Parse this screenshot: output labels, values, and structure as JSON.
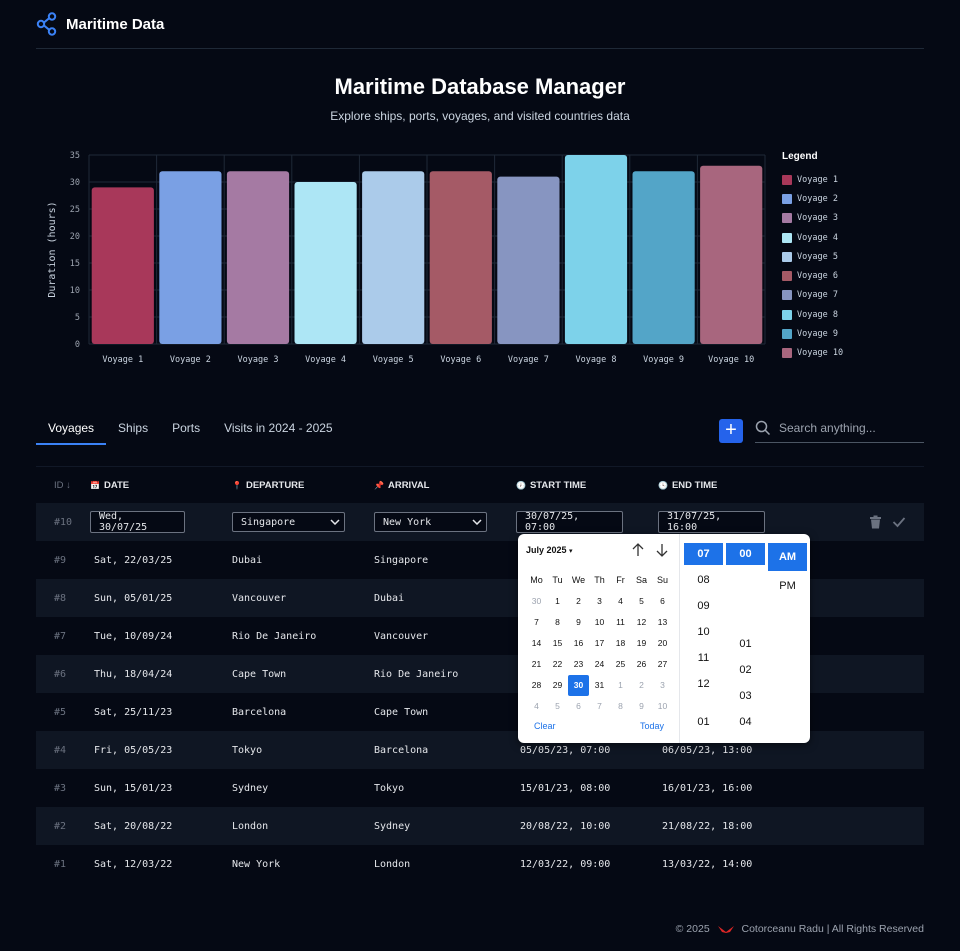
{
  "header": {
    "brand": "Maritime Data"
  },
  "hero": {
    "title": "Maritime Database Manager",
    "subtitle": "Explore ships, ports, voyages, and visited countries data"
  },
  "chart_data": {
    "type": "bar",
    "title": "",
    "xlabel": "",
    "ylabel": "Duration (hours)",
    "ylim": [
      0,
      35
    ],
    "yticks": [
      0,
      5,
      10,
      15,
      20,
      25,
      30,
      35
    ],
    "categories": [
      "Voyage 1",
      "Voyage 2",
      "Voyage 3",
      "Voyage 4",
      "Voyage 5",
      "Voyage 6",
      "Voyage 7",
      "Voyage 8",
      "Voyage 9",
      "Voyage 10"
    ],
    "values": [
      29,
      32,
      32,
      30,
      32,
      32,
      31,
      35,
      32,
      33
    ],
    "colors": [
      "#a8385a",
      "#7aa0e4",
      "#a57aa3",
      "#ade6f5",
      "#abcbea",
      "#a55a66",
      "#8795c1",
      "#7dd2ea",
      "#53a5c8",
      "#a8667e"
    ],
    "legend_title": "Legend",
    "legend_position": "right",
    "grid": true
  },
  "tabs": [
    "Voyages",
    "Ships",
    "Ports",
    "Visits in 2024 - 2025"
  ],
  "search": {
    "placeholder": "Search anything..."
  },
  "add_label": "+",
  "table": {
    "headers": {
      "id": "ID",
      "date": "DATE",
      "departure": "DEPARTURE",
      "arrival": "ARRIVAL",
      "start": "START TIME",
      "end": "END TIME"
    },
    "edit_row": {
      "id": "#10",
      "date": "Wed, 30/07/25",
      "departure": "Singapore",
      "arrival": "New York",
      "start": "30/07/25, 07:00",
      "end": "31/07/25, 16:00"
    },
    "rows": [
      {
        "id": "#9",
        "date": "Sat, 22/03/25",
        "departure": "Dubai",
        "arrival": "Singapore",
        "start": "",
        "end": ""
      },
      {
        "id": "#8",
        "date": "Sun, 05/01/25",
        "departure": "Vancouver",
        "arrival": "Dubai",
        "start": "",
        "end": ""
      },
      {
        "id": "#7",
        "date": "Tue, 10/09/24",
        "departure": "Rio De Janeiro",
        "arrival": "Vancouver",
        "start": "",
        "end": ""
      },
      {
        "id": "#6",
        "date": "Thu, 18/04/24",
        "departure": "Cape Town",
        "arrival": "Rio De Janeiro",
        "start": "",
        "end": ""
      },
      {
        "id": "#5",
        "date": "Sat, 25/11/23",
        "departure": "Barcelona",
        "arrival": "Cape Town",
        "start": "",
        "end": ""
      },
      {
        "id": "#4",
        "date": "Fri, 05/05/23",
        "departure": "Tokyo",
        "arrival": "Barcelona",
        "start": "05/05/23, 07:00",
        "end": "06/05/23, 13:00"
      },
      {
        "id": "#3",
        "date": "Sun, 15/01/23",
        "departure": "Sydney",
        "arrival": "Tokyo",
        "start": "15/01/23, 08:00",
        "end": "16/01/23, 16:00"
      },
      {
        "id": "#2",
        "date": "Sat, 20/08/22",
        "departure": "London",
        "arrival": "Sydney",
        "start": "20/08/22, 10:00",
        "end": "21/08/22, 18:00"
      },
      {
        "id": "#1",
        "date": "Sat, 12/03/22",
        "departure": "New York",
        "arrival": "London",
        "start": "12/03/22, 09:00",
        "end": "13/03/22, 14:00"
      }
    ]
  },
  "datepicker": {
    "month": "July 2025",
    "weekdays": [
      "Mo",
      "Tu",
      "We",
      "Th",
      "Fr",
      "Sa",
      "Su"
    ],
    "weeks": [
      [
        "30",
        "1",
        "2",
        "3",
        "4",
        "5",
        "6"
      ],
      [
        "7",
        "8",
        "9",
        "10",
        "11",
        "12",
        "13"
      ],
      [
        "14",
        "15",
        "16",
        "17",
        "18",
        "19",
        "20"
      ],
      [
        "21",
        "22",
        "23",
        "24",
        "25",
        "26",
        "27"
      ],
      [
        "28",
        "29",
        "30",
        "31",
        "1",
        "2",
        "3"
      ],
      [
        "4",
        "5",
        "6",
        "7",
        "8",
        "9",
        "10"
      ]
    ],
    "selected_day": "30",
    "clear": "Clear",
    "today": "Today",
    "hours": [
      "07",
      "08",
      "09",
      "10",
      "11",
      "12",
      "01"
    ],
    "minutes": [
      "00",
      "01",
      "02",
      "03",
      "04"
    ],
    "ampm": [
      "AM",
      "PM"
    ],
    "selected_hour": "07",
    "selected_minute": "00",
    "selected_ampm": "AM"
  },
  "footer": {
    "year": "© 2025",
    "text": "Cotorceanu Radu | All Rights Reserved"
  }
}
